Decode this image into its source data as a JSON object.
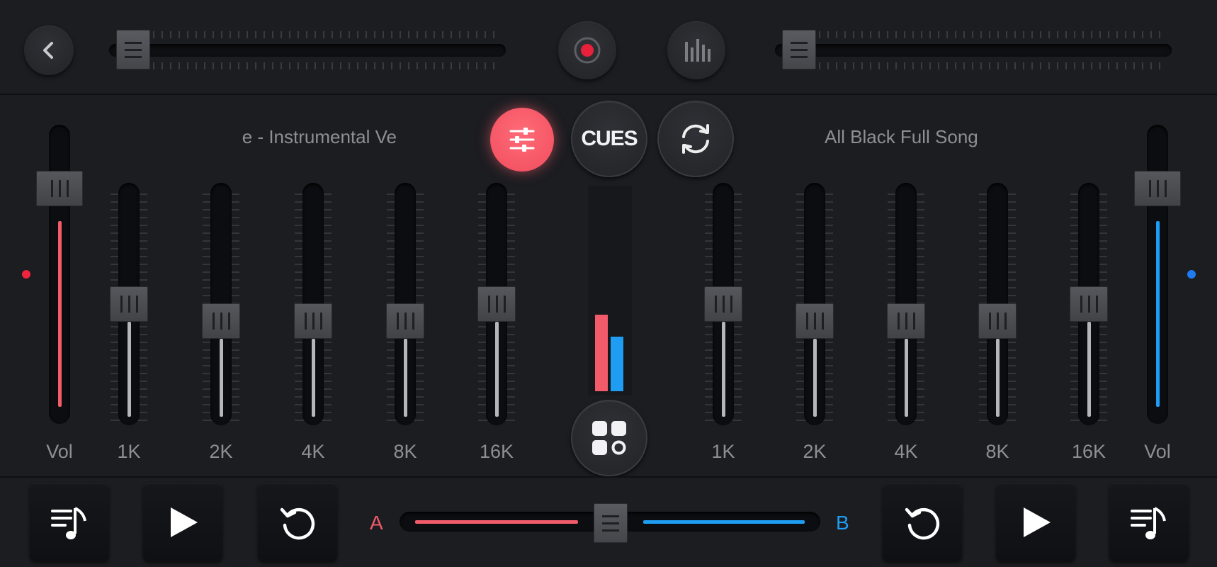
{
  "colors": {
    "deck_a": "#f25b6a",
    "deck_b": "#1e9df2",
    "background": "#1c1d21"
  },
  "header": {
    "back_icon": "chevron-left-icon",
    "record_icon": "record-icon",
    "spectrum_icon": "spectrum-bars-icon",
    "pitch_a": 0.04,
    "pitch_b": 0.04
  },
  "deck_a": {
    "title": "e - Instrumental Ve",
    "volume_label": "Vol",
    "volume_level": 0.68,
    "eq": [
      {
        "label": "1K",
        "level": 0.5
      },
      {
        "label": "2K",
        "level": 0.42
      },
      {
        "label": "4K",
        "level": 0.42
      },
      {
        "label": "8K",
        "level": 0.42
      },
      {
        "label": "16K",
        "level": 0.5
      }
    ]
  },
  "deck_b": {
    "title": "All Black Full Song",
    "volume_label": "Vol",
    "volume_level": 0.68,
    "eq": [
      {
        "label": "1K",
        "level": 0.5
      },
      {
        "label": "2K",
        "level": 0.42
      },
      {
        "label": "4K",
        "level": 0.42
      },
      {
        "label": "8K",
        "level": 0.42
      },
      {
        "label": "16K",
        "level": 0.5
      }
    ]
  },
  "center": {
    "mixer_icon": "sliders-icon",
    "cues_label": "CUES",
    "sync_icon": "sync-icon",
    "apps_icon": "grid-apps-icon",
    "meter_a": 0.38,
    "meter_b": 0.27
  },
  "bottom": {
    "playlist_icon": "playlist-music-icon",
    "play_icon": "play-icon",
    "reset_icon": "rotate-ccw-icon",
    "crossfader_a_label": "A",
    "crossfader_b_label": "B",
    "crossfader_position": 0.5
  }
}
